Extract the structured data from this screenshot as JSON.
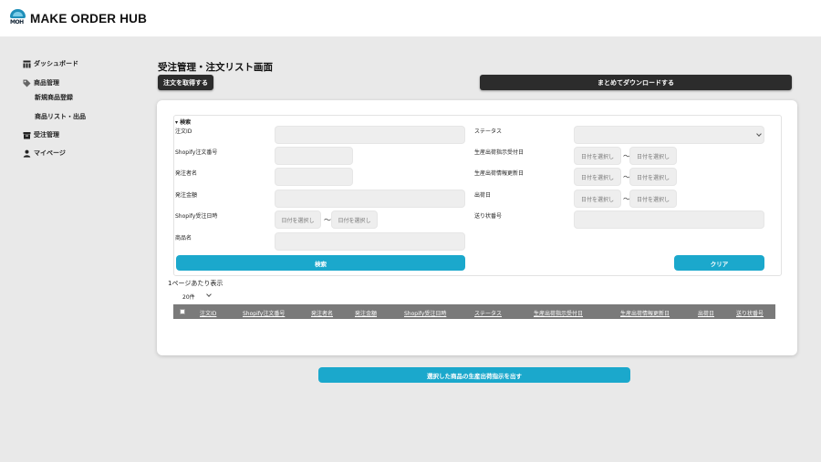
{
  "app": {
    "logo_text": "MOH",
    "brand": "MAKE ORDER HUB"
  },
  "sidebar": {
    "items": [
      {
        "label": "ダッシュボード",
        "icon": "dashboard-icon"
      },
      {
        "label": "商品管理",
        "icon": "tag-icon"
      },
      {
        "label": "新規商品登録"
      },
      {
        "label": "商品リスト・出品"
      },
      {
        "label": "受注管理",
        "icon": "archive-icon"
      },
      {
        "label": "マイページ",
        "icon": "person-icon"
      }
    ]
  },
  "main": {
    "title": "受注管理・注文リスト画面",
    "fetch_orders_label": "注文を取得する",
    "bulk_download_label": "まとめてダウンロードする",
    "search": {
      "toggle": "▾ 検索",
      "fields": {
        "order_id": "注文ID",
        "shopify_order_no": "Shopify注文番号",
        "orderer_name": "発注者名",
        "order_amount": "発注金額",
        "shopify_order_date": "Shopify受注日時",
        "product_name": "商品名",
        "status": "ステータス",
        "production_instruction_date": "生産出荷指示受付日",
        "production_update_date": "生産出荷情報更新日",
        "ship_date": "出荷日",
        "tracking_no": "送り状番号"
      },
      "date_placeholder": "日付を選択し",
      "range_separator": "〜",
      "search_button": "検索",
      "clear_button": "クリア"
    },
    "per_page_label": "1ページあたり表示",
    "per_page_value": "20件",
    "table": {
      "columns": [
        "注文ID",
        "Shopify注文番号",
        "発注者名",
        "発注金額",
        "Shopify受注日時",
        "ステータス",
        "生産出荷指示受付日",
        "生産出荷情報更新日",
        "出荷日",
        "送り状番号"
      ]
    },
    "submit_instruction_label": "選択した商品の生産出荷指示を出す"
  },
  "colors": {
    "accent": "#1ba8cc",
    "dark_button": "#2c2c2c",
    "table_header": "#7a7a7a",
    "background": "#e9e9e9"
  }
}
